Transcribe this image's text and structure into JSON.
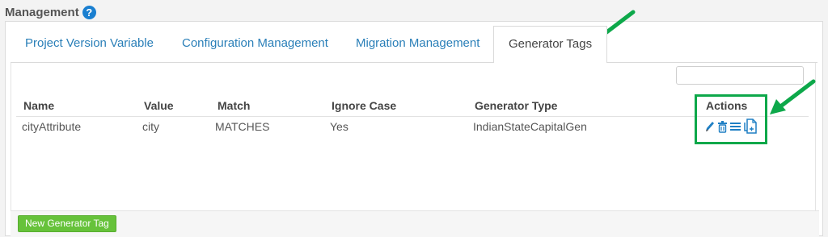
{
  "header": {
    "title": "Management",
    "help_icon": "question-circle-icon"
  },
  "tabs": [
    {
      "label": "Project Version Variable",
      "active": false
    },
    {
      "label": "Configuration Management",
      "active": false
    },
    {
      "label": "Migration Management",
      "active": false
    },
    {
      "label": "Generator Tags",
      "active": true
    }
  ],
  "filter": {
    "placeholder": "",
    "value": ""
  },
  "table": {
    "columns": [
      "Name",
      "Value",
      "Match",
      "Ignore Case",
      "Generator Type",
      "Actions"
    ],
    "rows": [
      {
        "name": "cityAttribute",
        "value": "city",
        "match": "MATCHES",
        "ignore_case": "Yes",
        "generator_type": "IndianStateCapitalGen"
      }
    ],
    "row_actions": [
      "pencil-icon",
      "trash-icon",
      "list-icon",
      "copy-document-icon"
    ]
  },
  "footer": {
    "new_button": "New Generator Tag"
  },
  "colors": {
    "link_blue": "#2a7fb8",
    "green_button": "#66c23a",
    "annotation_green": "#0da84a",
    "icon_blue": "#1f7fc4"
  }
}
